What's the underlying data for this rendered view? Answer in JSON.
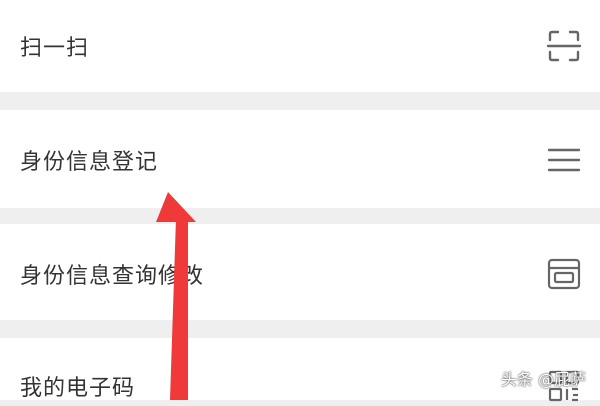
{
  "menu": {
    "items": [
      {
        "label": "扫一扫",
        "icon": "scan-icon"
      },
      {
        "label": "身份信息登记",
        "icon": "menu-lines-icon"
      },
      {
        "label": "身份信息查询修改",
        "icon": "id-card-icon"
      },
      {
        "label": "我的电子码",
        "icon": "qr-code-icon"
      }
    ]
  },
  "annotation": {
    "arrow_color": "#f03a3a"
  },
  "watermark": {
    "text": "头条 @屁萨"
  },
  "colors": {
    "background": "#efefef",
    "item_background": "#ffffff",
    "text": "#333333",
    "icon": "#666666"
  }
}
